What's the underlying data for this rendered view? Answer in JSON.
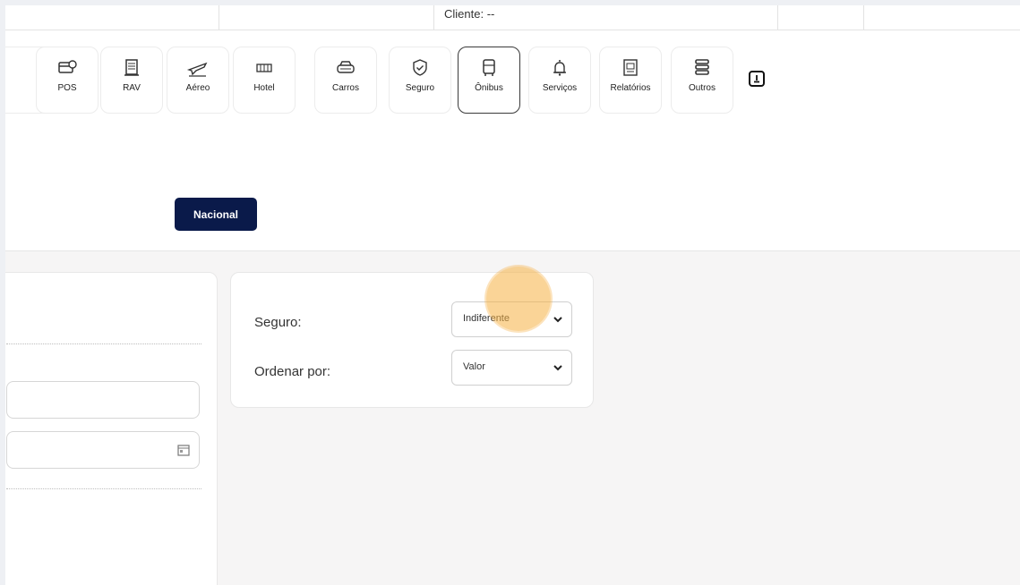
{
  "header": {
    "client_label": "Cliente: --"
  },
  "toolbar": {
    "items": [
      {
        "label": "",
        "icon": "partial-item-icon"
      },
      {
        "label": "POS",
        "icon": "pos-card-icon"
      },
      {
        "label": "RAV",
        "icon": "rav-document-icon"
      },
      {
        "label": "Aéreo",
        "icon": "airplane-icon"
      },
      {
        "label": "Hotel",
        "icon": "hotel-bed-icon"
      },
      {
        "label": "Carros",
        "icon": "car-icon"
      },
      {
        "label": "Seguro",
        "icon": "shield-check-icon"
      },
      {
        "label": "Ônibus",
        "icon": "bus-icon"
      },
      {
        "label": "Serviços",
        "icon": "bell-icon"
      },
      {
        "label": "Relatórios",
        "icon": "report-icon"
      },
      {
        "label": "Outros",
        "icon": "stack-icon"
      }
    ],
    "active": "Ônibus",
    "download_icon": "download-icon"
  },
  "scope": {
    "nacional_label": "Nacional"
  },
  "filters": {
    "seguro_label": "Seguro:",
    "seguro_value": "Indiferente",
    "ordenar_label": "Ordenar por:",
    "ordenar_value": "Valor"
  },
  "colors": {
    "primary": "#0a1a4a",
    "page_bg": "#f6f5f5",
    "cursor_highlight": "#f5b041"
  }
}
